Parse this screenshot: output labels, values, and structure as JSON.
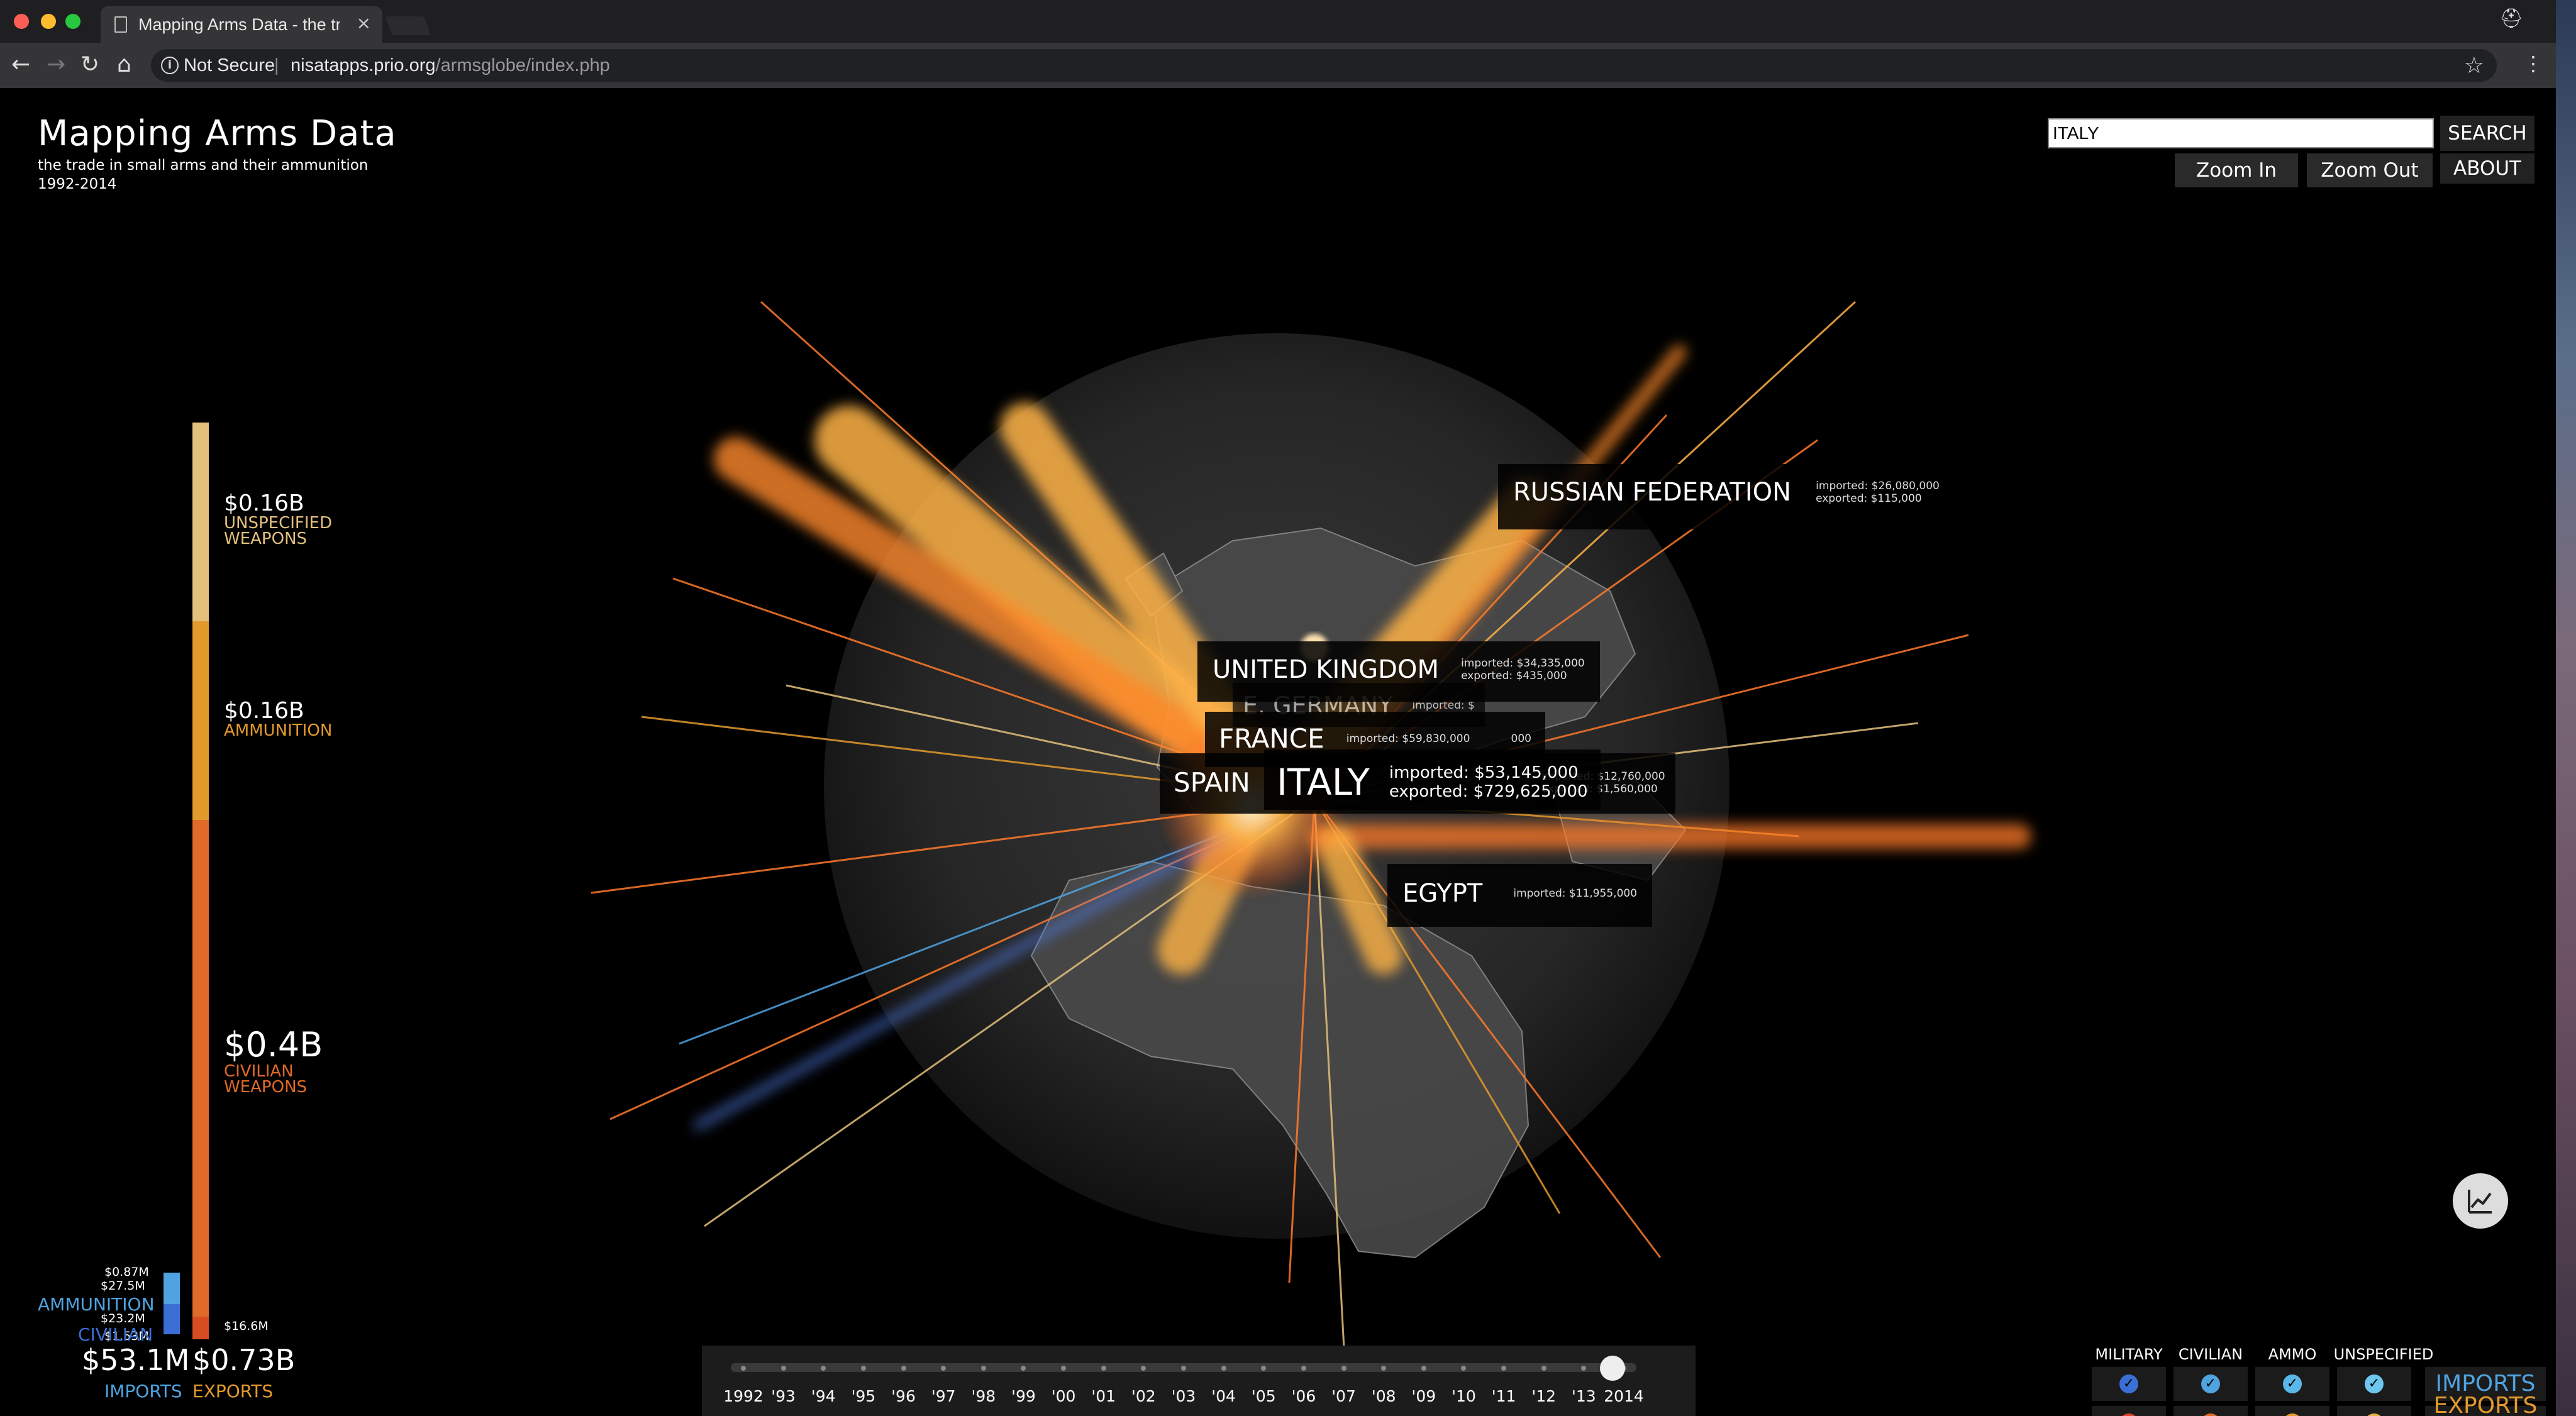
{
  "browser": {
    "tab_title": "Mapping Arms Data - the trade in small arms",
    "tab_close": "×",
    "security_label": "Not Secure",
    "url_host": "nisatapps.prio.org",
    "url_path": "/armsglobe/index.php",
    "icons": {
      "back": "back-arrow-icon",
      "forward": "forward-arrow-icon",
      "reload": "reload-icon",
      "home": "home-icon",
      "info": "info-icon",
      "bookmark": "star-icon",
      "menu": "kebab-menu-icon",
      "profile": "profile-icon"
    }
  },
  "header": {
    "title": "Mapping Arms Data",
    "subtitle": "the trade in small arms and their ammunition",
    "years": "1992-2014"
  },
  "controls": {
    "search_value": "ITALY",
    "search_button": "SEARCH",
    "zoom_in": "Zoom In",
    "zoom_out": "Zoom Out",
    "about": "ABOUT"
  },
  "legend": {
    "segments": [
      {
        "value": "$0.16B",
        "label_line1": "UNSPECIFIED",
        "label_line2": "WEAPONS",
        "color": "#e3c07c"
      },
      {
        "value": "$0.16B",
        "label_line1": "AMMUNITION",
        "label_line2": "",
        "color": "#e39a2c"
      },
      {
        "value": "$0.4B",
        "label_line1": "CIVILIAN",
        "label_line2": "WEAPONS",
        "color": "#e06a28"
      }
    ],
    "bottom_value": "$16.6M",
    "import_values": [
      "$0.87M",
      "$27.5M",
      "$23.2M",
      "$1.53M"
    ],
    "import_labels": [
      "AMMUNITION",
      "CIVILIAN"
    ],
    "imports_total": "$53.1M",
    "exports_total": "$0.73B",
    "imports_label": "IMPORTS",
    "exports_label": "EXPORTS",
    "import_color": "#4fa3e0",
    "export_color": "#e39a2c"
  },
  "countries": [
    {
      "name": "RUSSIAN FEDERATION",
      "imported": "imported: $26,080,000",
      "exported": "exported: $115,000"
    },
    {
      "name": "UNITED KINGDOM",
      "imported": "imported: $34,335,000",
      "exported": "exported: $435,000"
    },
    {
      "name": "E. GERMANY",
      "imported": "imported: $",
      "exported": ""
    },
    {
      "name": "FRANCE",
      "imported": "imported: $59,830,000",
      "exported": "000"
    },
    {
      "name": "SPAIN",
      "imported": "imported: $12,760,000",
      "exported": "exported: $1,560,000"
    },
    {
      "name": "ITALY",
      "imported": "imported: $53,145,000",
      "exported": "exported: $729,625,000"
    },
    {
      "name": "EGYPT",
      "imported": "imported: $11,955,000",
      "exported": ""
    }
  ],
  "timeline": {
    "years": [
      "1992",
      "'93",
      "'94",
      "'95",
      "'96",
      "'97",
      "'98",
      "'99",
      "'00",
      "'01",
      "'02",
      "'03",
      "'04",
      "'05",
      "'06",
      "'07",
      "'08",
      "'09",
      "'10",
      "'11",
      "'12",
      "'13",
      "2014"
    ],
    "selected_year": "2014"
  },
  "filters": {
    "columns": [
      "MILITARY",
      "CIVILIAN",
      "AMMO",
      "UNSPECIFIED"
    ],
    "imports_label": "IMPORTS",
    "exports_label": "EXPORTS",
    "check_glyph": "✓",
    "imports_colors": [
      "#3b6fd6",
      "#4fa3e0",
      "#5ab8e8",
      "#6cc6ee"
    ],
    "exports_colors": [
      "#e0452b",
      "#e06a28",
      "#e39a2c",
      "#e3b04a"
    ]
  },
  "chart_toggle_icon": "line-chart-icon"
}
